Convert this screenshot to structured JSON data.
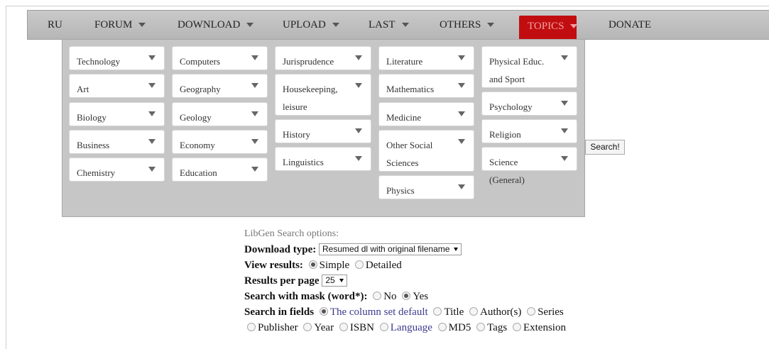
{
  "navbar": {
    "items": [
      {
        "label": "RU"
      },
      {
        "label": "FORUM"
      },
      {
        "label": "DOWNLOAD"
      },
      {
        "label": "UPLOAD"
      },
      {
        "label": "LAST"
      },
      {
        "label": "OTHERS"
      },
      {
        "label": "TOPICS",
        "active": true
      },
      {
        "label": "DONATE"
      }
    ]
  },
  "topics": [
    [
      "Technology",
      "Art",
      "Biology",
      "Business",
      "Chemistry"
    ],
    [
      "Computers",
      "Geography",
      "Geology",
      "Economy",
      "Education"
    ],
    [
      "Jurisprudence",
      "Housekeeping, leisure",
      "History",
      "Linguistics"
    ],
    [
      "Literature",
      "Mathematics",
      "Medicine",
      "Other Social Sciences",
      "Physics"
    ],
    [
      "Physical Educ. and Sport",
      "Psychology",
      "Religion",
      "Science (General)"
    ]
  ],
  "search": {
    "button_label": "Search!"
  },
  "options": {
    "heading": "LibGen Search options:",
    "download_type_label": "Download type:",
    "download_type_value": "Resumed dl with original filename",
    "view_results_label": "View results:",
    "view_simple": "Simple",
    "view_detailed": "Detailed",
    "per_page_label": "Results per page",
    "per_page_value": "25",
    "mask_label": "Search with mask (word*):",
    "mask_no": "No",
    "mask_yes": "Yes",
    "fields_label": "Search in fields",
    "fields": [
      "The column set default",
      "Title",
      "Author(s)",
      "Series",
      "Publisher",
      "Year",
      "ISBN",
      "Language",
      "MD5",
      "Tags",
      "Extension"
    ]
  }
}
